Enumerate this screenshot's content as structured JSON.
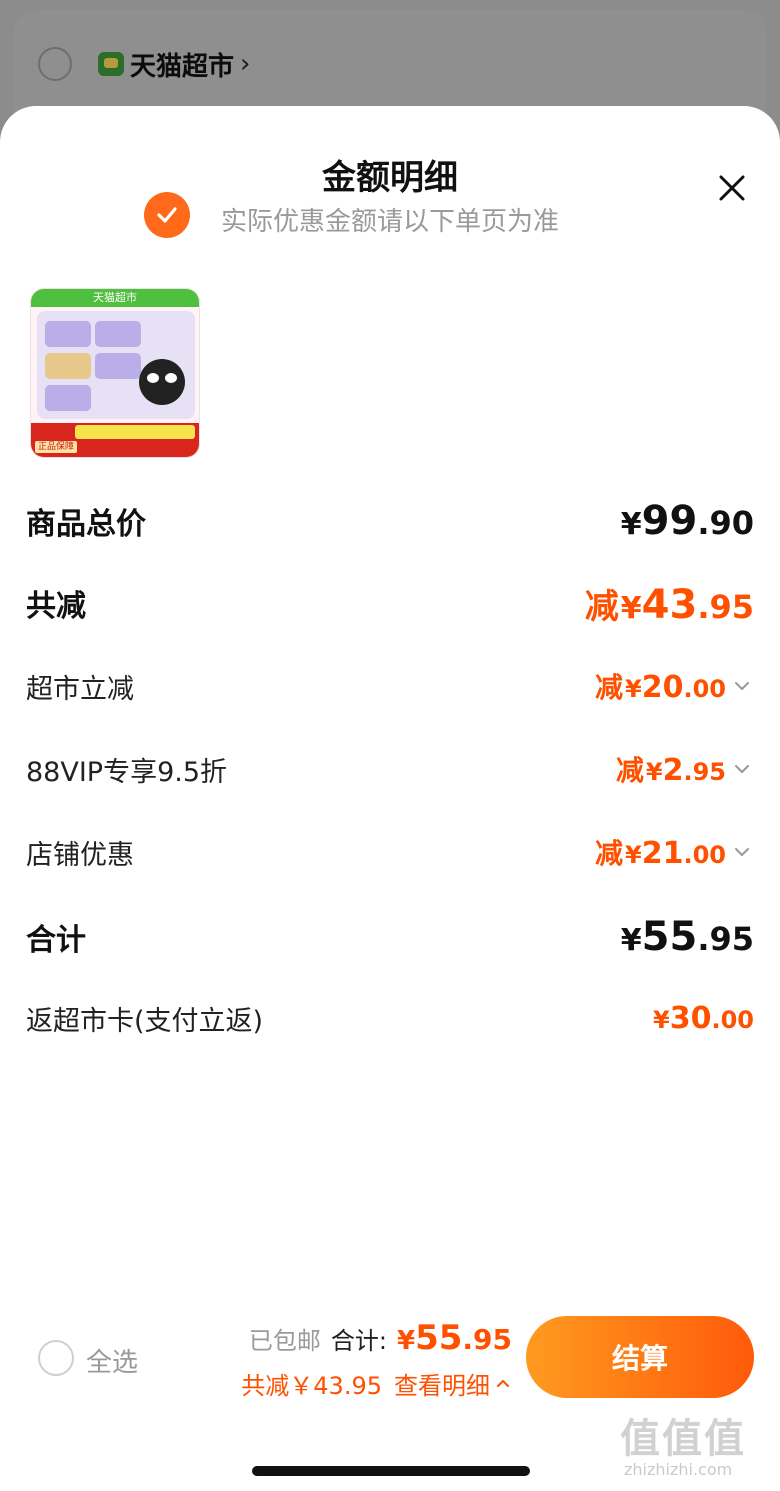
{
  "background": {
    "shop_name": "天猫超市",
    "shop_chevron": "›"
  },
  "sheet": {
    "title": "金额明细",
    "subtitle": "实际优惠金额请以下单页为准"
  },
  "product": {
    "thumb_top_text": "天猫超市",
    "thumb_badge_text": "正品保障"
  },
  "rows": {
    "subtotal": {
      "label": "商品总价",
      "yen": "¥",
      "int": "99",
      "dec": ".90"
    },
    "total_discount": {
      "label": "共减",
      "prefix": "减",
      "yen": "¥",
      "int": "43",
      "dec": ".95"
    },
    "discounts": [
      {
        "label": "超市立减",
        "prefix": "减",
        "yen": "¥",
        "int": "20",
        "dec": ".00"
      },
      {
        "label": "88VIP专享9.5折",
        "prefix": "减",
        "yen": "¥",
        "int": "2",
        "dec": ".95"
      },
      {
        "label": "店铺优惠",
        "prefix": "减",
        "yen": "¥",
        "int": "21",
        "dec": ".00"
      }
    ],
    "grand_total": {
      "label": "合计",
      "yen": "¥",
      "int": "55",
      "dec": ".95"
    },
    "rebate": {
      "label": "返超市卡(支付立返)",
      "yen": "¥",
      "int": "30",
      "dec": ".00"
    }
  },
  "bottom_bar": {
    "select_all_label": "全选",
    "free_shipping": "已包邮",
    "total_label": "合计:",
    "total_yen": "¥",
    "total_int": "55",
    "total_dec": ".95",
    "discount_summary": "共减￥43.95",
    "view_detail": "查看明细",
    "checkout_label": "结算"
  },
  "watermark": {
    "glyphs": "值值值",
    "url": "zhizhizhi.com"
  },
  "colors": {
    "accent": "#ff5000",
    "checkout_start": "#ff9a1f",
    "checkout_end": "#ff5a0a"
  },
  "icons": {
    "close": "close-icon",
    "check": "check-icon",
    "chevron_down": "chevron-down-icon",
    "chevron_up": "chevron-up-icon"
  }
}
